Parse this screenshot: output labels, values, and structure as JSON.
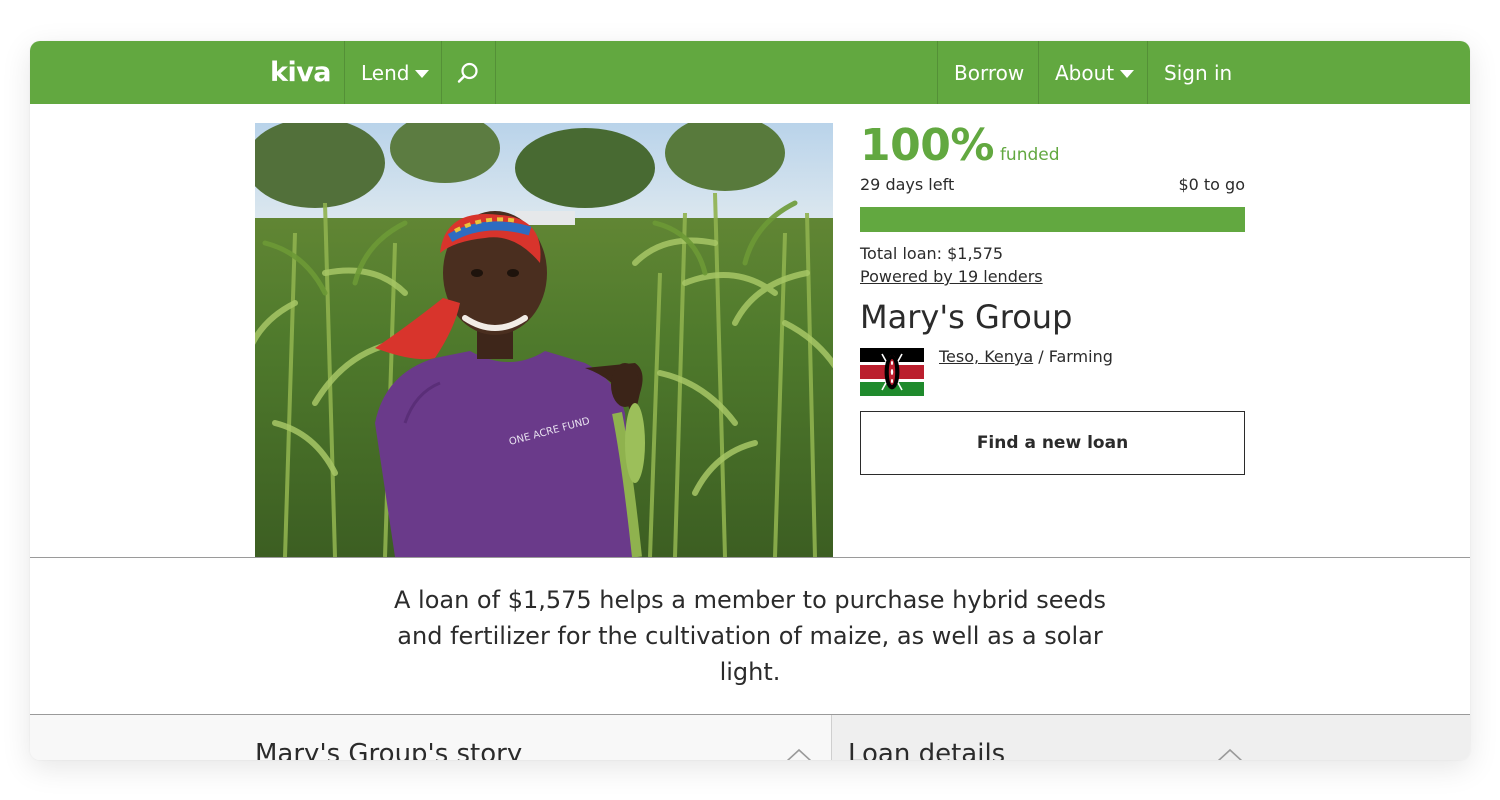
{
  "nav": {
    "logo": "kiva",
    "lend": "Lend",
    "borrow": "Borrow",
    "about": "About",
    "sign_in": "Sign in",
    "search_icon": "search-icon",
    "bg_color": "#62a840"
  },
  "loan": {
    "funded_percent": "100%",
    "funded_word": "funded",
    "funded_fraction": 1.0,
    "days_left": "29 days left",
    "to_go": "$0 to go",
    "total": "Total loan: $1,575",
    "lenders": "Powered by 19 lenders",
    "borrower_name": "Mary's Group",
    "location": "Teso, Kenya",
    "sector_separator": " / ",
    "sector": "Farming",
    "flag_icon": "kenya-flag-icon",
    "find_button": "Find a new loan"
  },
  "summary": "A loan of $1,575 helps a member to purchase hybrid seeds and fertilizer for the cultivation of maize, as well as a solar light.",
  "sections": {
    "story_title": "Mary's Group's story",
    "details_title": "Loan details",
    "chevron_icon": "chevron-up-icon"
  }
}
